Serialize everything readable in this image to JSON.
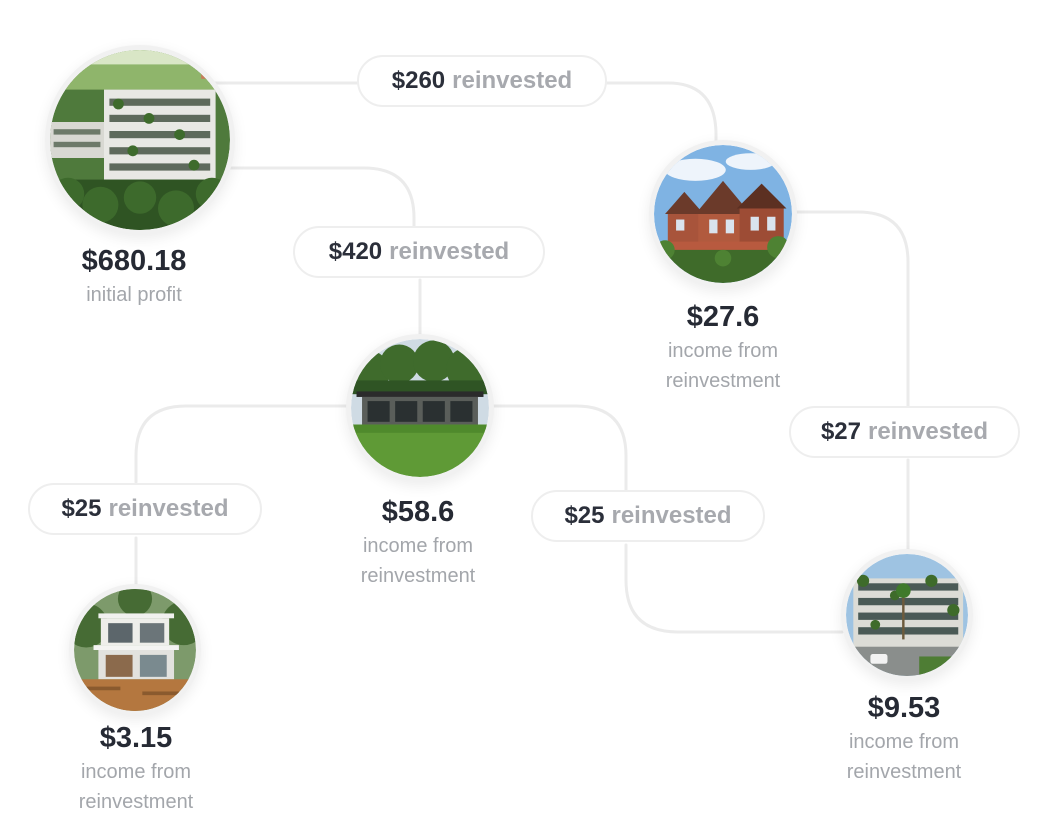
{
  "nodes": {
    "root": {
      "value": "$680.18",
      "line1": "initial profit",
      "line2": ""
    },
    "center": {
      "value": "$58.6",
      "line1": "income from",
      "line2": "reinvestment"
    },
    "topRight": {
      "value": "$27.6",
      "line1": "income from",
      "line2": "reinvestment"
    },
    "bottomLeft": {
      "value": "$3.15",
      "line1": "income from",
      "line2": "reinvestment"
    },
    "bottomRight": {
      "value": "$9.53",
      "line1": "income from",
      "line2": "reinvestment"
    }
  },
  "pills": {
    "p260": {
      "amount": "$260",
      "word": "reinvested"
    },
    "p420": {
      "amount": "$420",
      "word": "reinvested"
    },
    "p27": {
      "amount": "$27",
      "word": "reinvested"
    },
    "p25a": {
      "amount": "$25",
      "word": "reinvested"
    },
    "p25b": {
      "amount": "$25",
      "word": "reinvested"
    }
  },
  "colors": {
    "connector": "#ebebeb",
    "valueText": "#262a34",
    "mutedText": "#a3a6ab"
  }
}
